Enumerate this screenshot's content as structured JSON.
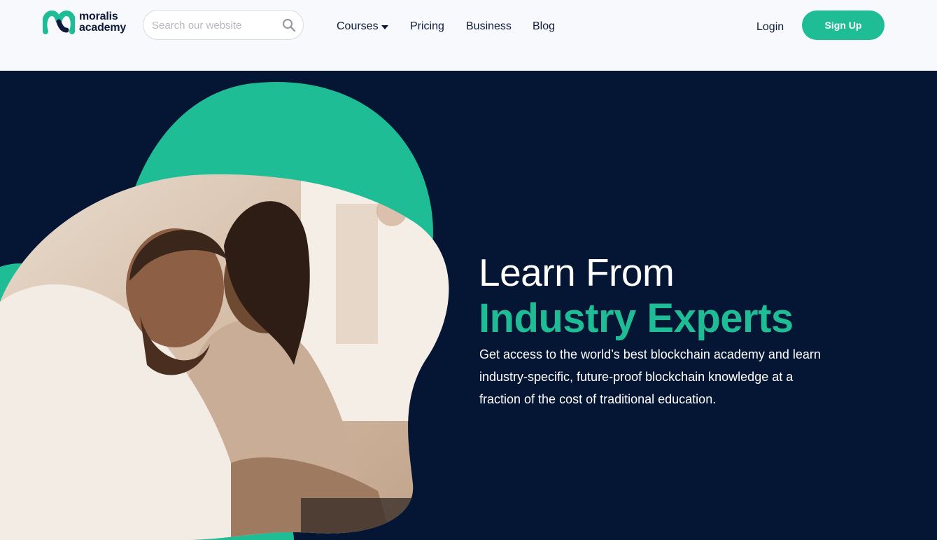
{
  "brand": {
    "name_line1": "moralis",
    "name_line2": "academy",
    "logo_icon": "moralis-m-logo",
    "accent_color": "#1fbd96",
    "dark_color": "#051534"
  },
  "search": {
    "placeholder": "Search our website",
    "value": "",
    "icon": "search-icon"
  },
  "nav": {
    "courses": "Courses",
    "courses_icon": "caret-down-icon",
    "pricing": "Pricing",
    "business": "Business",
    "blog": "Blog"
  },
  "auth": {
    "login": "Login",
    "signup": "Sign Up"
  },
  "hero": {
    "title": "Learn From",
    "highlight": "Industry Experts",
    "description": "Get access to the world’s best blockchain academy and learn industry-specific, future-proof blockchain knowledge at a fraction of the cost of traditional education.",
    "image": "photo of two people studying at a laptop"
  }
}
